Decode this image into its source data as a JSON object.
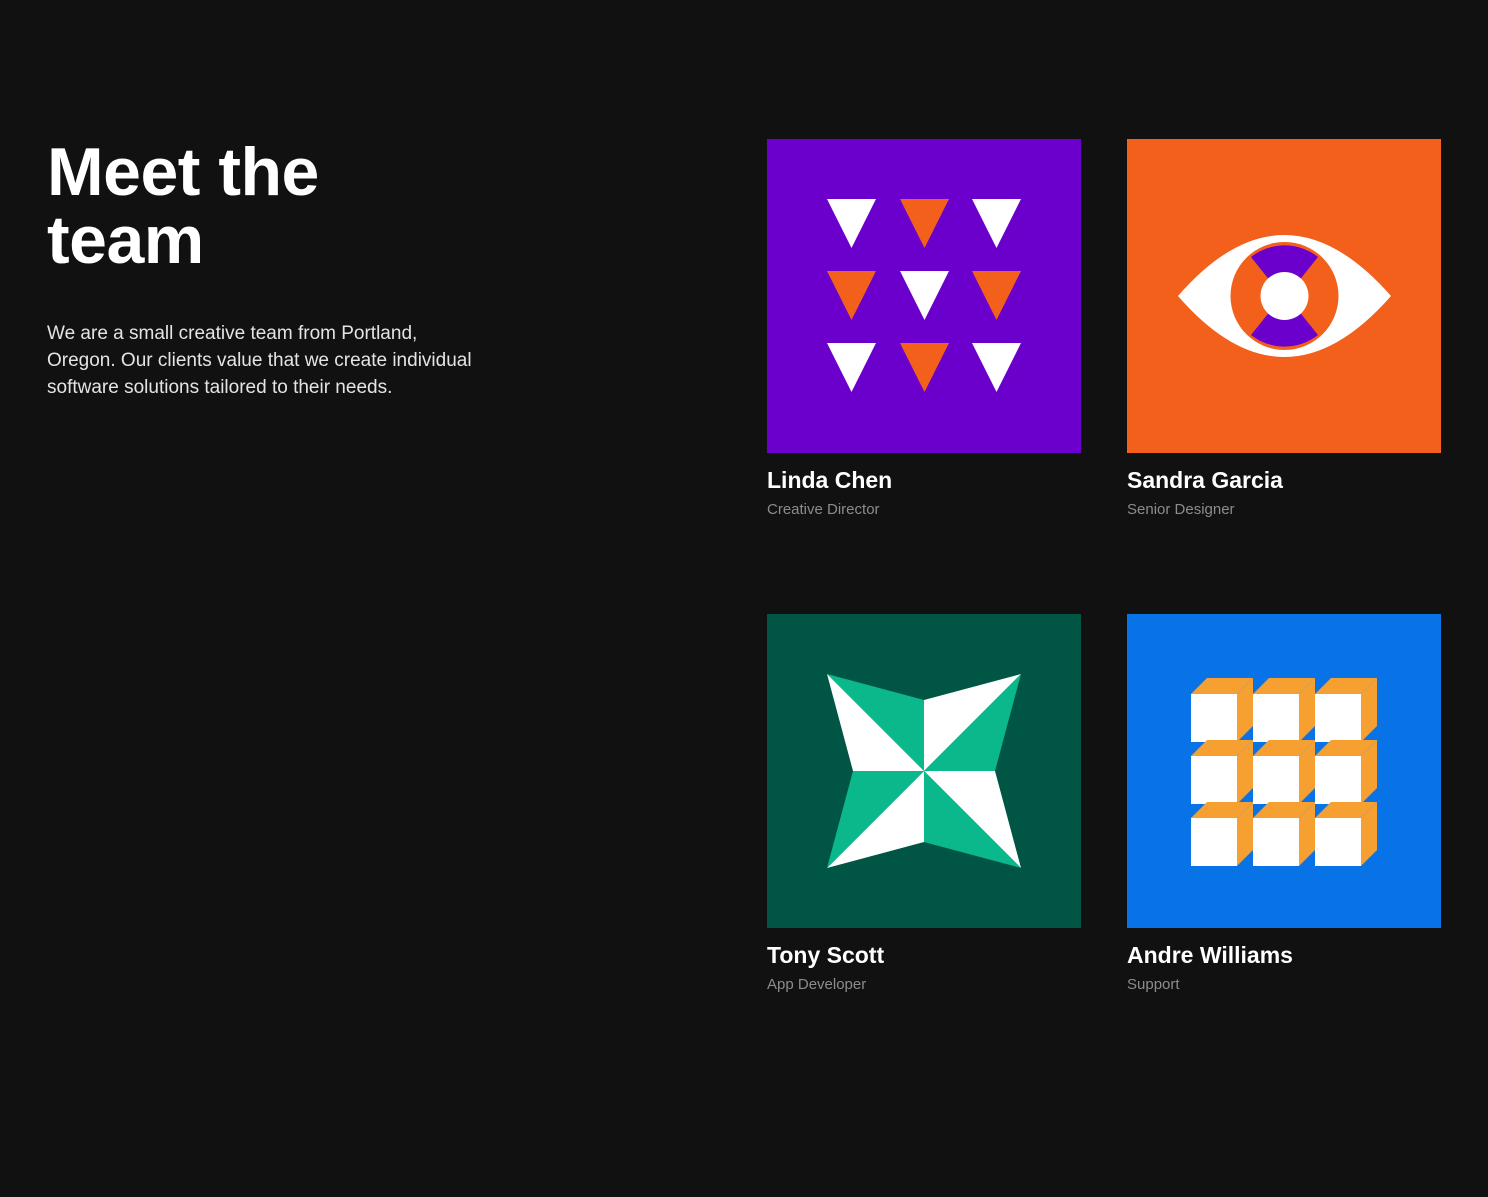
{
  "intro": {
    "title": "Meet the team",
    "description": "We are a small creative team from Portland, Oregon. Our clients value that we create individual software solutions tailored to their needs."
  },
  "colors": {
    "background": "#111111",
    "purple": "#6b00cc",
    "orange": "#f2601c",
    "dark_green": "#005544",
    "green": "#0bb88b",
    "blue": "#0873e6",
    "amber": "#f5a030",
    "white": "#ffffff"
  },
  "team": [
    {
      "name": "Linda Chen",
      "role": "Creative Director",
      "icon": "triangle-grid-icon"
    },
    {
      "name": "Sandra Garcia",
      "role": "Senior Designer",
      "icon": "eye-icon"
    },
    {
      "name": "Tony Scott",
      "role": "App Developer",
      "icon": "star-pinwheel-icon"
    },
    {
      "name": "Andre Williams",
      "role": "Support",
      "icon": "cube-grid-icon"
    }
  ]
}
